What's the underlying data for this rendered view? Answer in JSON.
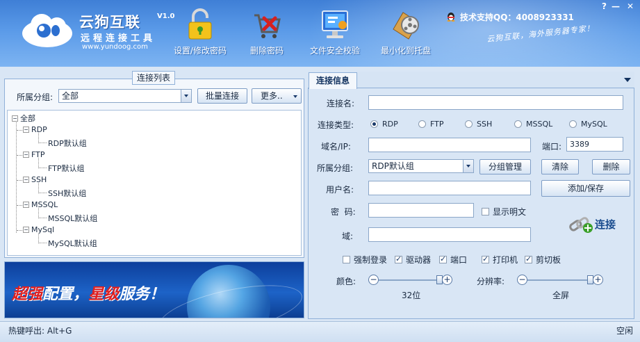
{
  "header": {
    "title": "云狗互联",
    "version": "V1.0",
    "subtitle": "远程连接工具",
    "site": "www.yundoog.com",
    "support": "技术支持QQ：4008923331",
    "slogan": "云狗互联，海外服务器专家！",
    "help": "?",
    "minimize": "—",
    "close": "✕",
    "tools": [
      {
        "label": "设置/修改密码",
        "icon": "lock-icon"
      },
      {
        "label": "删除密码",
        "icon": "delete-cart-icon"
      },
      {
        "label": "文件安全校验",
        "icon": "monitor-check-icon"
      },
      {
        "label": "最小化到托盘",
        "icon": "film-reel-icon"
      }
    ]
  },
  "left": {
    "group_title": "连接列表",
    "group_label": "所属分组:",
    "group_value": "全部",
    "batch_button": "批量连接",
    "more_button": "更多..",
    "tree": {
      "root": "全部",
      "categories": [
        {
          "name": "RDP",
          "child": "RDP默认组"
        },
        {
          "name": "FTP",
          "child": "FTP默认组"
        },
        {
          "name": "SSH",
          "child": "SSH默认组"
        },
        {
          "name": "MSSQL",
          "child": "MSSQL默认组"
        },
        {
          "name": "MySql",
          "child": "MySQL默认组"
        }
      ]
    },
    "banner": {
      "part1": "超强",
      "part2": "配置，",
      "part3": "星级",
      "part4": "服务！"
    }
  },
  "right": {
    "tab": "连接信息",
    "name_label": "连接名:",
    "type_label": "连接类型:",
    "types": [
      "RDP",
      "FTP",
      "SSH",
      "MSSQL",
      "MySQL"
    ],
    "selected_type": "RDP",
    "domain_ip_label": "域名/IP:",
    "port_label": "端口:",
    "port_value": "3389",
    "group_label": "所属分组:",
    "group_value": "RDP默认组",
    "group_manage": "分组管理",
    "clear": "清除",
    "delete": "删除",
    "user_label": "用户名:",
    "add_save": "添加/保存",
    "password_label": "密  码:",
    "show_plain": "显示明文",
    "domain_label": "域:",
    "connect": "连接",
    "options": [
      {
        "label": "强制登录",
        "checked": false
      },
      {
        "label": "驱动器",
        "checked": true
      },
      {
        "label": "端口",
        "checked": true
      },
      {
        "label": "打印机",
        "checked": true
      },
      {
        "label": "剪切板",
        "checked": true
      }
    ],
    "color_label": "颜色:",
    "color_value": "32位",
    "color_level": 1.0,
    "resolution_label": "分辨率:",
    "resolution_value": "全屏",
    "resolution_level": 1.0
  },
  "status": {
    "hotkey": "热键呼出: Alt+G",
    "state": "空闲"
  }
}
